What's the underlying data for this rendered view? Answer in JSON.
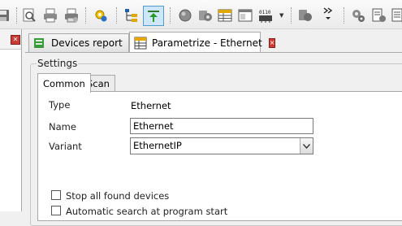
{
  "toolbar": {
    "icons": [
      "floppy-icon",
      "print-preview-icon",
      "print-icon",
      "print-setup-icon",
      "settings-gear-icon",
      "tree-icon",
      "pin-icon",
      "circle-icon",
      "devices-icon",
      "table-icon",
      "window-icon",
      "chip-icon",
      "chip-dropdown-icon",
      "device-stack-icon",
      "overflow-chevron-icon",
      "gears-icon",
      "report-icon",
      "report-list-icon"
    ]
  },
  "tabs": [
    {
      "label": "Devices report",
      "icon": "devices-report-icon",
      "close": "×"
    },
    {
      "label": "Parametrize - Ethernet",
      "icon": "table-grid-icon",
      "close": "×"
    }
  ],
  "settings": {
    "legend": "Settings",
    "tabs": [
      {
        "label": "Common"
      },
      {
        "label": "Scan"
      }
    ],
    "type_label": "Type",
    "type_value": "Ethernet",
    "name_label": "Name",
    "name_value": "Ethernet",
    "variant_label": "Variant",
    "variant_value": "EthernetIP",
    "stop_devices_label": "Stop all found devices",
    "auto_search_label": "Automatic search at program start"
  },
  "colors": {
    "close_red": "#d23a31",
    "pressed_blue": "#cfe6f8",
    "tab_border": "#a9a9a9"
  }
}
